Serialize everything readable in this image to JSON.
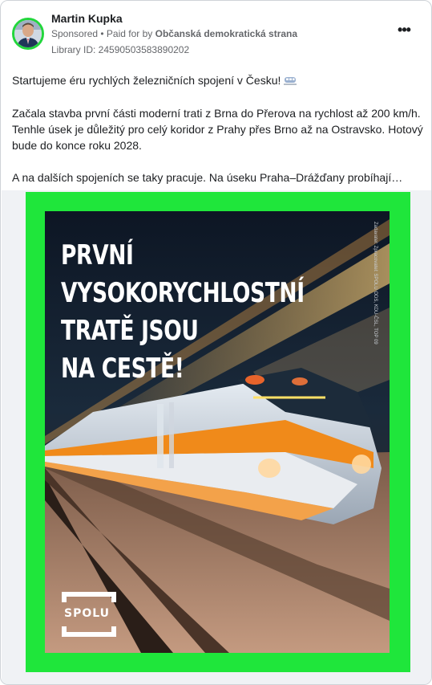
{
  "post": {
    "author": "Martin Kupka",
    "sponsored": "Sponsored",
    "paid_for_prefix": " • Paid for by ",
    "paid_for_org": "Občanská demokratická strana",
    "library_id": "Library ID: 24590503583890202",
    "more_label": "•••",
    "paragraphs": [
      "Startujeme éru rychlých železničních spojení v Česku!",
      "Začala stavba první části moderní trati z Brna do Přerova na rychlost až 200 km/h. Tenhle úsek je důležitý pro celý koridor z Prahy přes Brno až na Ostravsko. Hotový bude do konce roku 2028.",
      "A na dalších spojeních se taky pracuje. Na úseku Praha–Drážďany probíhají…"
    ]
  },
  "ad_image": {
    "headline": "PRVNÍ\nVYSOKORYCHLOSTNÍ\nTRATĚ JSOU\nNA CESTĚ!",
    "side_note": "Zadavatel: Zpracovatel: SPOLU ODS, KDU-ČSL, TOP 09",
    "logo": "SPOLU",
    "frame_color": "#1fe63b"
  }
}
